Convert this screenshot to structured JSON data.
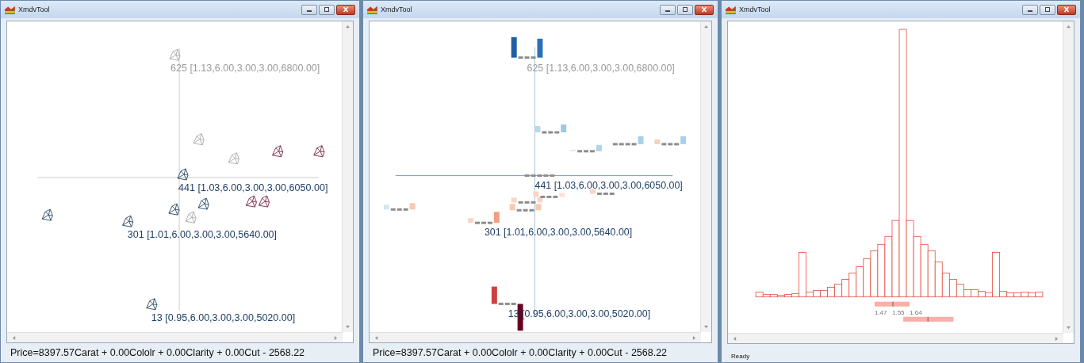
{
  "windows": [
    {
      "title": "XmdvTool",
      "kind": "glyphs",
      "labels": [
        {
          "text": "625 [1.13,6.00,3.00,3.00,6800.00]",
          "color": "#9a9a9a"
        },
        {
          "text": "441 [1.03,6.00,3.00,3.00,6050.00]",
          "color": "#1f3f66"
        },
        {
          "text": "301 [1.01,6.00,3.00,3.00,5640.00]",
          "color": "#1f3f66"
        },
        {
          "text": "13 [0.95,6.00,3.00,3.00,5020.00]",
          "color": "#1f3f66"
        }
      ],
      "status": "Price=8397.57Carat + 0.00Cololr + 0.00Clarity + 0.00Cut - 2568.22"
    },
    {
      "title": "XmdvTool",
      "kind": "bars",
      "labels": [
        {
          "text": "625 [1.13,6.00,3.00,3.00,6800.00]",
          "color": "#9a9a9a"
        },
        {
          "text": "441 [1.03,6.00,3.00,3.00,6050.00]",
          "color": "#1f3f66"
        },
        {
          "text": "301 [1.01,6.00,3.00,3.00,5640.00]",
          "color": "#1f3f66"
        },
        {
          "text": "13 [0.95,6.00,3.00,3.00,5020.00]",
          "color": "#1f3f66"
        }
      ],
      "status": "Price=8397.57Carat + 0.00Cololr + 0.00Clarity + 0.00Cut - 2568.22"
    },
    {
      "title": "XmdvTool",
      "kind": "histogram",
      "range_labels": [
        "1.47",
        "1.55",
        "1.64"
      ],
      "status": "Ready"
    }
  ]
}
